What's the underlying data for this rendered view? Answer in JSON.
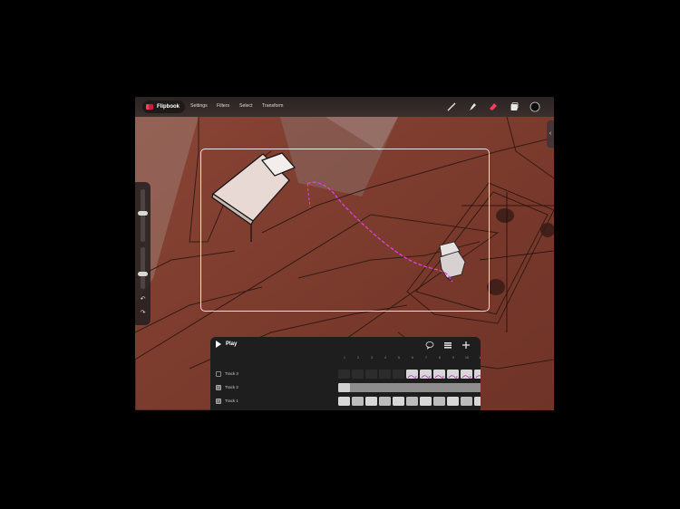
{
  "app": {
    "name": "Flipbook",
    "accent": "#ff3b5c"
  },
  "menu": [
    {
      "label": "Settings"
    },
    {
      "label": "Filters"
    },
    {
      "label": "Select"
    },
    {
      "label": "Transform"
    }
  ],
  "tools": [
    {
      "name": "brush-icon"
    },
    {
      "name": "smudge-icon"
    },
    {
      "name": "eraser-icon",
      "active_color": "#ff3b5c"
    },
    {
      "name": "layers-icon"
    },
    {
      "name": "color-swatch-icon",
      "color": "#0d0d0d"
    }
  ],
  "sidebar": {
    "size_slider_level": 0.55,
    "opacity_slider_level": 0.35,
    "buttons": [
      {
        "name": "undo-icon"
      },
      {
        "name": "redo-icon"
      }
    ]
  },
  "timeline": {
    "play_label": "Play",
    "header_icons": [
      "comment-icon",
      "onion-skin-icon",
      "add-icon"
    ],
    "frame_numbers": [
      "1",
      "2",
      "3",
      "4",
      "5",
      "6",
      "7",
      "8",
      "9",
      "10",
      "11"
    ],
    "tracks": [
      {
        "label": "Track 3",
        "checked": false
      },
      {
        "label": "Track 2",
        "checked": true
      },
      {
        "label": "Track 1",
        "checked": true
      }
    ]
  }
}
